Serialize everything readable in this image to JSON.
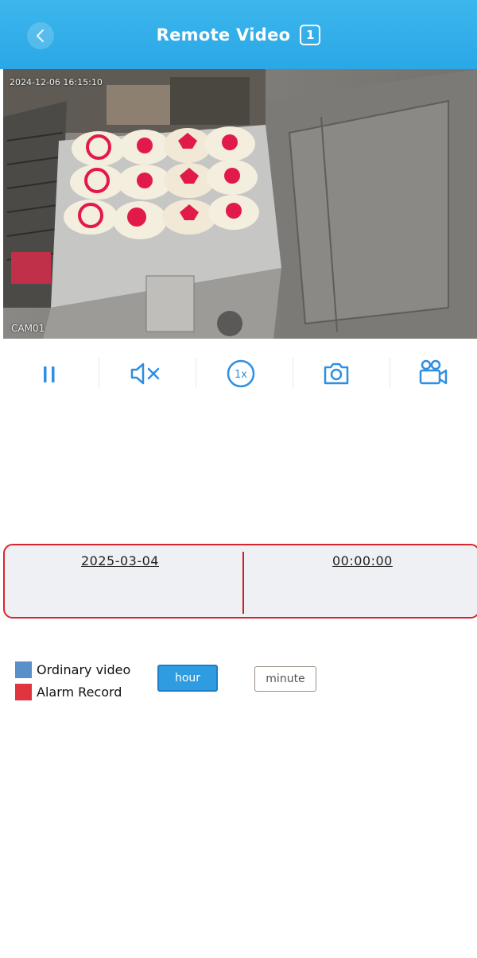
{
  "header": {
    "title": "Remote Video",
    "camera_count": "1",
    "background_color": "#2aa7e6"
  },
  "video": {
    "timestamp": "2024-12-06 16:15:10",
    "camera_label": "CAM01"
  },
  "controls": {
    "items": [
      {
        "name": "pause",
        "icon": "pause-icon"
      },
      {
        "name": "mute",
        "icon": "speaker-muted-icon"
      },
      {
        "name": "speed",
        "icon": "speed-1x-icon"
      },
      {
        "name": "snapshot",
        "icon": "camera-icon"
      },
      {
        "name": "record",
        "icon": "video-camera-icon"
      }
    ],
    "icon_color": "#2f8fe0"
  },
  "timeline": {
    "date": "2025-03-04",
    "time": "00:00:00",
    "cursor_color": "#c9202a"
  },
  "legend": {
    "items": [
      {
        "label": "Ordinary video",
        "color": "#5b8fc9"
      },
      {
        "label": "Alarm Record",
        "color": "#e0353f"
      }
    ]
  },
  "scale_buttons": {
    "hour": "hour",
    "minute": "minute",
    "active": "hour"
  }
}
